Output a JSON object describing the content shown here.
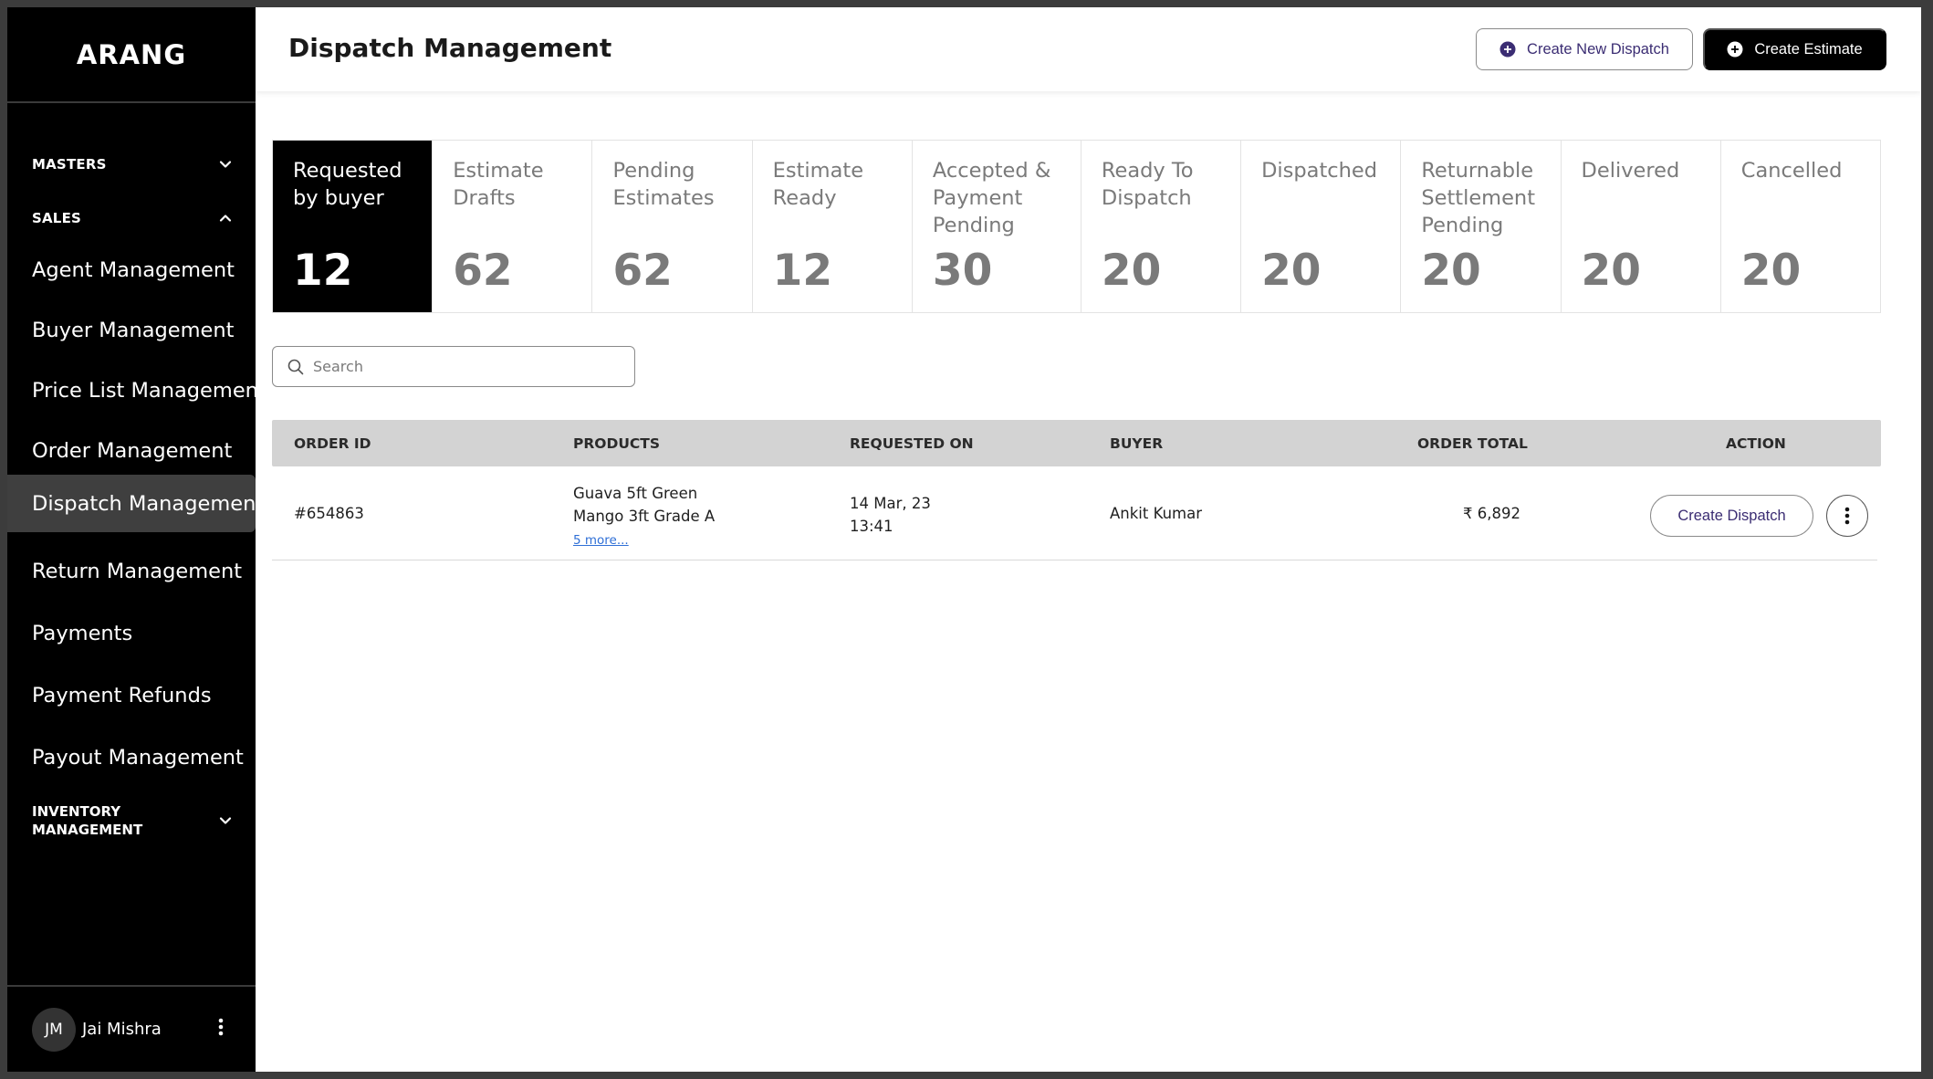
{
  "app": {
    "logo": "ARANG"
  },
  "sidebar": {
    "sections": {
      "masters": "MASTERS",
      "sales": "SALES",
      "inventory_line1": "INVENTORY",
      "inventory_line2": "MANAGEMENT"
    },
    "items": [
      {
        "label": "Agent Management"
      },
      {
        "label": "Buyer Management"
      },
      {
        "label": "Price List Management"
      },
      {
        "label": "Order Management"
      },
      {
        "label": "Dispatch Management",
        "active": true
      },
      {
        "label": "Return Management"
      },
      {
        "label": "Payments"
      },
      {
        "label": "Payment Refunds"
      },
      {
        "label": "Payout Management"
      }
    ],
    "user": {
      "initials": "JM",
      "name": "Jai Mishra"
    }
  },
  "header": {
    "title": "Dispatch Management",
    "create_new_dispatch": "Create New Dispatch",
    "create_estimate": "Create Estimate"
  },
  "status_cards": [
    {
      "label": "Requested by buyer",
      "count": "12",
      "active": true
    },
    {
      "label": "Estimate Drafts",
      "count": "62"
    },
    {
      "label": "Pending Estimates",
      "count": "62"
    },
    {
      "label": "Estimate Ready",
      "count": "12"
    },
    {
      "label": "Accepted & Payment Pending",
      "count": "30"
    },
    {
      "label": "Ready To Dispatch",
      "count": "20"
    },
    {
      "label": "Dispatched",
      "count": "20"
    },
    {
      "label": "Returnable Settlement Pending",
      "count": "20"
    },
    {
      "label": "Delivered",
      "count": "20"
    },
    {
      "label": "Cancelled",
      "count": "20"
    }
  ],
  "search": {
    "placeholder": "Search",
    "value": ""
  },
  "table": {
    "headers": {
      "order_id": "ORDER ID",
      "products": "PRODUCTS",
      "requested_on": "REQUESTED ON",
      "buyer": "BUYER",
      "order_total": "ORDER TOTAL",
      "action": "ACTION"
    },
    "rows": [
      {
        "order_id": "#654863",
        "product_1": "Guava 5ft Green",
        "product_2": "Mango 3ft Grade A",
        "more": "5 more...",
        "date": "14 Mar, 23",
        "time": "13:41",
        "buyer": "Ankit Kumar",
        "total": "₹ 6,892",
        "action_label": "Create Dispatch"
      }
    ]
  },
  "colors": {
    "sidebar_bg": "#000000",
    "active_nav_bg": "#3f3f3f",
    "active_card_bg": "#000000",
    "accent_text": "#3b2d73",
    "link": "#2f6fd6",
    "table_head_bg": "#d3d3d3"
  }
}
